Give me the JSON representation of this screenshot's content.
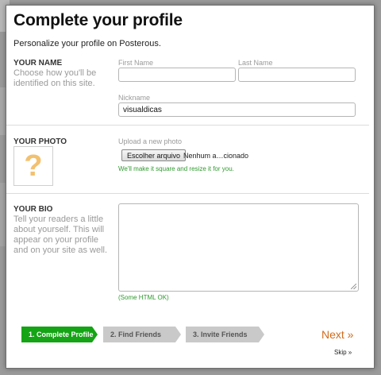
{
  "modal": {
    "title": "Complete your profile",
    "subtitle": "Personalize your profile on Posterous."
  },
  "name_section": {
    "label": "YOUR NAME",
    "description": "Choose how you'll be identified on this site.",
    "first_name_label": "First Name",
    "first_name_value": "",
    "last_name_label": "Last Name",
    "last_name_value": "",
    "nickname_label": "Nickname",
    "nickname_value": "visualdicas"
  },
  "photo_section": {
    "label": "YOUR PHOTO",
    "placeholder_glyph": "?",
    "upload_label": "Upload a new photo",
    "file_button": "Escolher arquivo",
    "file_status": "Nenhum a…cionado",
    "hint": "We'll make it square and resize it for you."
  },
  "bio_section": {
    "label": "YOUR BIO",
    "description": "Tell your readers a little about yourself. This will appear on your profile and on your site as well.",
    "value": "",
    "hint": "(Some HTML OK)"
  },
  "steps": [
    {
      "label": "1. Complete Profile",
      "state": "active"
    },
    {
      "label": "2. Find Friends",
      "state": "inactive"
    },
    {
      "label": "3. Invite Friends",
      "state": "inactive"
    }
  ],
  "nav": {
    "next": "Next »",
    "skip": "Skip »"
  },
  "colors": {
    "accent_green": "#15a415",
    "next_orange": "#d06c1d",
    "hint_green": "#2e9a2e"
  }
}
